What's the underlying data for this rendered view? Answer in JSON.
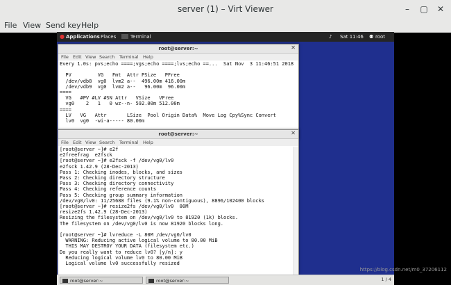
{
  "window": {
    "title": "server (1) – Virt Viewer"
  },
  "menu": {
    "file": "File",
    "view": "View",
    "send_key": "Send key",
    "help": "Help"
  },
  "guest_top": {
    "applications": "Applications",
    "places": "Places",
    "terminal": "Terminal",
    "clock": "Sat 11:46",
    "user": "root"
  },
  "term1": {
    "title": "root@server:~",
    "menu": [
      "File",
      "Edit",
      "View",
      "Search",
      "Terminal",
      "Help"
    ],
    "lines": [
      "Every 1.0s: pvs;echo ====;vgs;echo ====;lvs;echo ==...  Sat Nov  3 11:46:51 2018",
      "",
      "  PV         VG   Fmt  Attr PSize   PFree",
      "  /dev/vdb8  vg0  lvm2 a--  496.00m 416.00m",
      "  /dev/vdb9  vg0  lvm2 a--   96.00m  96.00m",
      "====",
      "  VG   #PV #LV #SN Attr   VSize   VFree",
      "  vg0    2   1   0 wz--n- 592.00m 512.00m",
      "====",
      "  LV   VG   Attr       LSize  Pool Origin Data%  Move Log Cpy%Sync Convert",
      "  lv0  vg0  -wi-a----- 80.00m"
    ]
  },
  "term2": {
    "title": "root@server:~",
    "menu": [
      "File",
      "Edit",
      "View",
      "Search",
      "Terminal",
      "Help"
    ],
    "lines": [
      "[root@server ~]# e2f",
      "e2freefrag  e2fsck",
      "[root@server ~]# e2fsck -f /dev/vg0/lv0",
      "e2fsck 1.42.9 (28-Dec-2013)",
      "Pass 1: Checking inodes, blocks, and sizes",
      "Pass 2: Checking directory structure",
      "Pass 3: Checking directory connectivity",
      "Pass 4: Checking reference counts",
      "Pass 5: Checking group summary information",
      "/dev/vg0/lv0: 11/25688 files (9.1% non-contiguous), 8896/102400 blocks",
      "[root@server ~]# resize2fs /dev/vg0/lv0  80M",
      "resize2fs 1.42.9 (28-Dec-2013)",
      "Resizing the filesystem on /dev/vg0/lv0 to 81920 (1k) blocks.",
      "The filesystem on /dev/vg0/lv0 is now 81920 blocks long.",
      "",
      "[root@server ~]# lvreduce -L 80M /dev/vg0/lv0",
      "  WARNING: Reducing active logical volume to 80.00 MiB",
      "  THIS MAY DESTROY YOUR DATA (filesystem etc.)",
      "Do you really want to reduce lv0? [y/n]: y",
      "  Reducing logical volume lv0 to 80.00 MiB",
      "  Logical volume lv0 successfully resized"
    ]
  },
  "taskbar": {
    "task1": "root@server:~",
    "task2": "root@server:~",
    "pager": "1 / 4"
  },
  "watermark": "https://blog.csdn.net/m0_37206112"
}
